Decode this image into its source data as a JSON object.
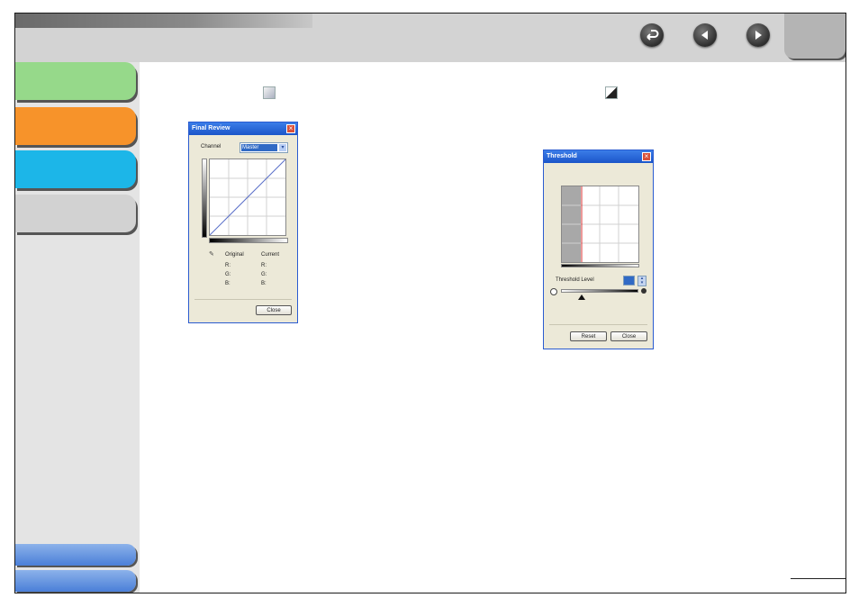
{
  "nav": {
    "icons": [
      "back-return-icon",
      "previous-page-icon",
      "next-page-icon"
    ]
  },
  "sidebar": {
    "tab_colors": [
      "#96d98a",
      "#f7932a",
      "#1cb6e8",
      "#d2d2d2"
    ],
    "bottom_tab_color": "#5b8ee0"
  },
  "final_review": {
    "title": "Final Review",
    "channel_label": "Channel",
    "channel_value": "Master",
    "original_label": "Original",
    "current_label": "Current",
    "rows": [
      {
        "label": "R:",
        "value": "R:"
      },
      {
        "label": "G:",
        "value": "G:"
      },
      {
        "label": "B:",
        "value": "B:"
      }
    ],
    "close_label": "Close"
  },
  "threshold": {
    "title": "Threshold",
    "level_label": "Threshold Level",
    "level_value": "",
    "reset_label": "Reset",
    "close_label": "Close"
  }
}
